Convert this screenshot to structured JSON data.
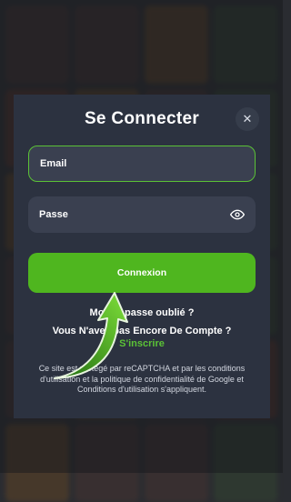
{
  "modal": {
    "title": "Se Connecter",
    "close_icon": "close-icon",
    "email_placeholder": "Email",
    "password_placeholder": "Passe",
    "password_toggle_icon": "eye-icon",
    "login_button": "Connexion",
    "forgot_password": "Mot de passe oublié ?",
    "no_account": "Vous N'avez pas Encore De Compte ?",
    "signup_link": "S'inscrire",
    "legal": "Ce site est protégé par reCAPTCHA et par les conditions d'utilisation et la politique de confidentialité de Google et Conditions d'utilisation s'appliquent."
  },
  "annotation": {
    "icon": "curved-arrow-icon"
  },
  "colors": {
    "accent": "#4fb61f",
    "modal_bg": "#2c3240",
    "field_bg": "#3a4050"
  }
}
